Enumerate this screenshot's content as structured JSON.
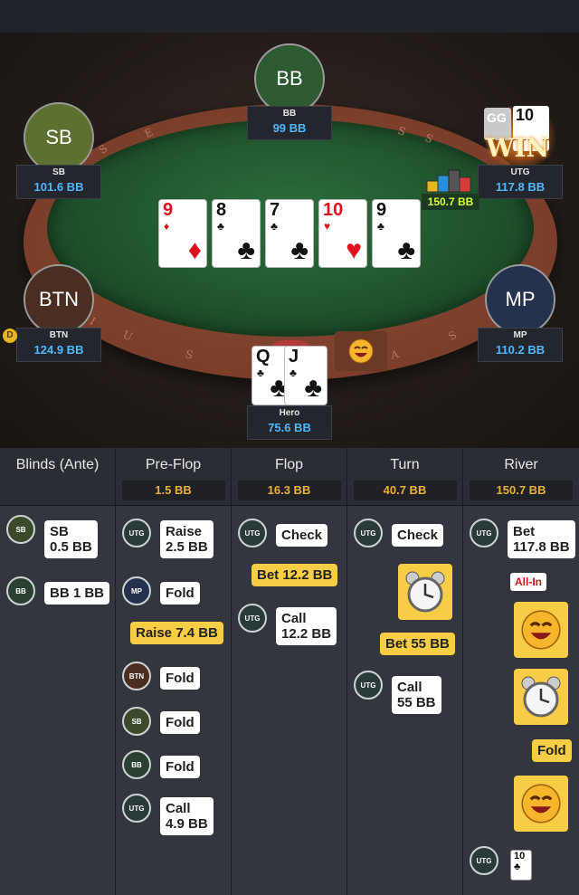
{
  "colors": {
    "stack_blue": "#4fb8ff",
    "pot_gold": "#e8b23a",
    "bet_yellow": "#f7cd45",
    "felt_green": "#1d4f29",
    "pot_green_text": "#d8ff3a"
  },
  "table": {
    "rail_letters": [
      "S",
      "E",
      "S",
      "S",
      "I",
      "U",
      "S",
      "A",
      "S"
    ],
    "pot": "150.7 BB",
    "dealer_button": "D",
    "win_badge": "WIN",
    "seats": {
      "bb": {
        "avatar": "BB",
        "position": "BB",
        "stack": "99 BB",
        "color": "#2e5a32"
      },
      "sb": {
        "avatar": "SB",
        "position": "SB",
        "stack": "101.6 BB",
        "color": "#5c7030"
      },
      "utg": {
        "position": "UTG",
        "stack": "117.8 BB"
      },
      "btn": {
        "avatar": "BTN",
        "position": "BTN",
        "stack": "124.9 BB",
        "color": "#4a2e22"
      },
      "mp": {
        "avatar": "MP",
        "position": "MP",
        "stack": "110.2 BB",
        "color": "#25324e"
      },
      "hero": {
        "position": "Hero",
        "stack": "75.6 BB"
      }
    },
    "board": [
      {
        "rank": "9",
        "suit": "♦",
        "color": "red"
      },
      {
        "rank": "8",
        "suit": "♣",
        "color": "black"
      },
      {
        "rank": "7",
        "suit": "♣",
        "color": "black"
      },
      {
        "rank": "10",
        "suit": "♥",
        "color": "red"
      },
      {
        "rank": "9",
        "suit": "♣",
        "color": "black"
      }
    ],
    "hero_cards": [
      {
        "rank": "Q",
        "suit": "♣"
      },
      {
        "rank": "J",
        "suit": "♣"
      }
    ],
    "utg_card": {
      "rank": "10"
    },
    "utg_badge": "GG"
  },
  "history": {
    "columns": [
      {
        "title": "Blinds (Ante)",
        "pot": ""
      },
      {
        "title": "Pre-Flop",
        "pot": "1.5 BB"
      },
      {
        "title": "Flop",
        "pot": "16.3 BB"
      },
      {
        "title": "Turn",
        "pot": "40.7 BB"
      },
      {
        "title": "River",
        "pot": "150.7 BB"
      }
    ],
    "blinds": [
      {
        "who": "SB",
        "line1": "SB",
        "line2": "0.5 BB"
      },
      {
        "who": "BB",
        "line1": "BB 1 BB"
      }
    ],
    "preflop": [
      {
        "who": "UTG",
        "line1": "Raise",
        "line2": "2.5 BB"
      },
      {
        "who": "MP",
        "line1": "Fold"
      },
      {
        "hero": "Raise 7.4 BB"
      },
      {
        "who": "BTN",
        "line1": "Fold"
      },
      {
        "who": "SB",
        "line1": "Fold"
      },
      {
        "who": "BB",
        "line1": "Fold"
      },
      {
        "who": "UTG",
        "line1": "Call",
        "line2": "4.9 BB"
      }
    ],
    "flop": [
      {
        "who": "UTG",
        "line1": "Check"
      },
      {
        "hero": "Bet 12.2 BB"
      },
      {
        "who": "UTG",
        "line1": "Call",
        "line2": "12.2 BB"
      }
    ],
    "turn": [
      {
        "who": "UTG",
        "line1": "Check"
      },
      {
        "hero": "Bet 55 BB"
      },
      {
        "who": "UTG",
        "line1": "Call",
        "line2": "55 BB"
      }
    ],
    "river": [
      {
        "who": "UTG",
        "line1": "Bet",
        "line2": "117.8 BB"
      },
      {
        "badge": "All-In"
      },
      {
        "hero": "Fold"
      },
      {
        "who": "UTG",
        "card": "10"
      }
    ]
  }
}
